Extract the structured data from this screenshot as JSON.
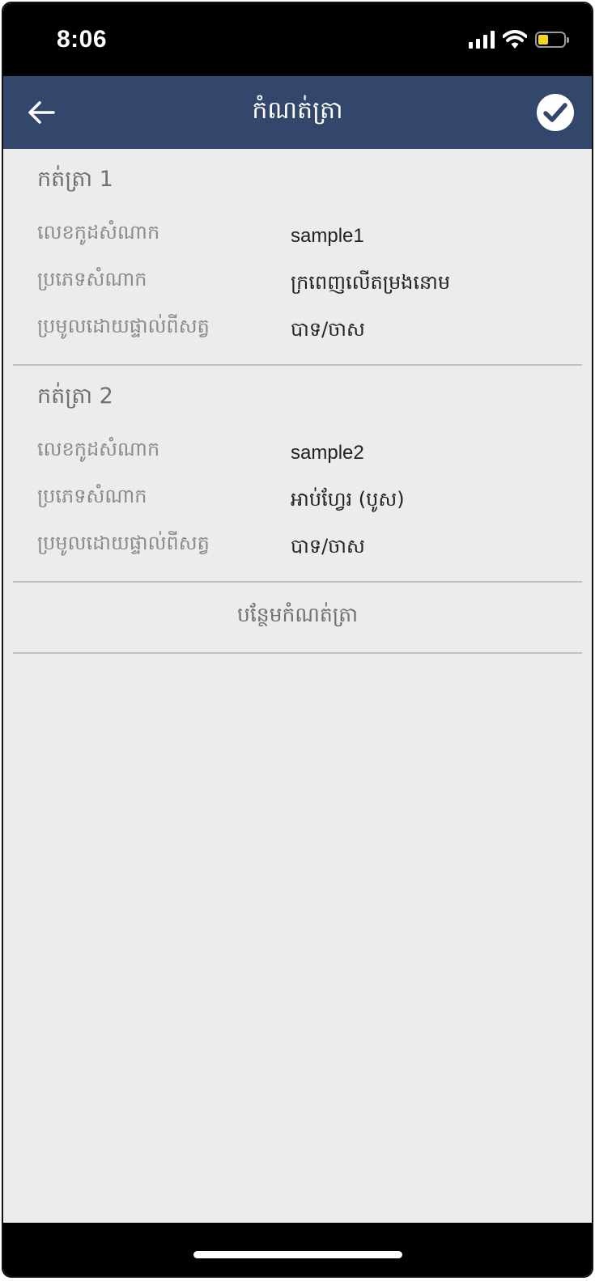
{
  "status_bar": {
    "time": "8:06"
  },
  "nav": {
    "title": "កំណត់ត្រា"
  },
  "samples": [
    {
      "title": "កត់ត្រា 1",
      "fields": [
        {
          "label": "លេខកូដសំណាក",
          "value": "sample1"
        },
        {
          "label": "ប្រភេទសំណាក",
          "value": "ក្រពេញលើតម្រងនោម"
        },
        {
          "label": "ប្រមូលដោយផ្ទាល់ពីសត្វ",
          "value": "បាទ/ចាស"
        }
      ]
    },
    {
      "title": "កត់ត្រា 2",
      "fields": [
        {
          "label": "លេខកូដសំណាក",
          "value": "sample2"
        },
        {
          "label": "ប្រភេទសំណាក",
          "value": "អាប់ហ្វែរ (បូស)"
        },
        {
          "label": "ប្រមូលដោយផ្ទាល់ពីសត្វ",
          "value": "បាទ/ចាស"
        }
      ]
    }
  ],
  "add_record_label": "បន្ថែមកំណត់ត្រា",
  "colors": {
    "nav_background": "#33466b",
    "content_background": "#ececec",
    "battery_fill": "#f5d61a"
  },
  "icons": {
    "back": "arrow-left-icon",
    "confirm": "check-circle-icon",
    "signal": "cellular-signal-icon",
    "wifi": "wifi-icon",
    "battery": "battery-low-icon"
  }
}
